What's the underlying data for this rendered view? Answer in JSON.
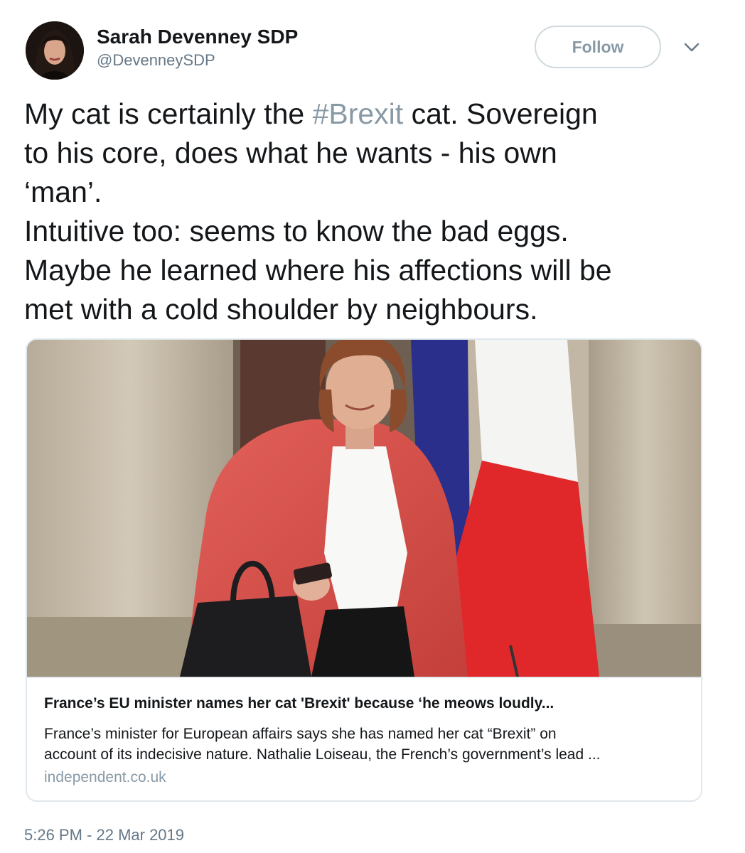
{
  "author": {
    "name": "Sarah Devenney SDP",
    "handle": "@DevenneySDP"
  },
  "follow_label": "Follow",
  "tweet": {
    "lines": [
      {
        "before": "My cat is certainly the ",
        "hashtag": "#Brexit",
        "after": " cat. Sovereign"
      },
      {
        "text": "to his core, does what he wants - his own"
      },
      {
        "text": "‘man’."
      },
      {
        "text": "Intuitive too: seems to know the bad eggs."
      },
      {
        "text": "Maybe he learned where his affections will be"
      },
      {
        "text": "met with a cold shoulder by neighbours."
      }
    ]
  },
  "card": {
    "title": "France’s EU minister names her cat 'Brexit' because ‘he meows loudly...",
    "description_lines": [
      "France’s minister for European affairs says she has named her cat “Brexit” on",
      "account of its indecisive nature. Nathalie Loiseau, the French’s government’s lead ..."
    ],
    "domain": "independent.co.uk"
  },
  "timestamp": "5:26 PM - 22 Mar 2019",
  "colors": {
    "hashtag": "#8899a6",
    "secondary_text": "#657786",
    "border": "#e1e8ed",
    "flag_blue": "#2a2f8c",
    "flag_red": "#e0282b"
  }
}
